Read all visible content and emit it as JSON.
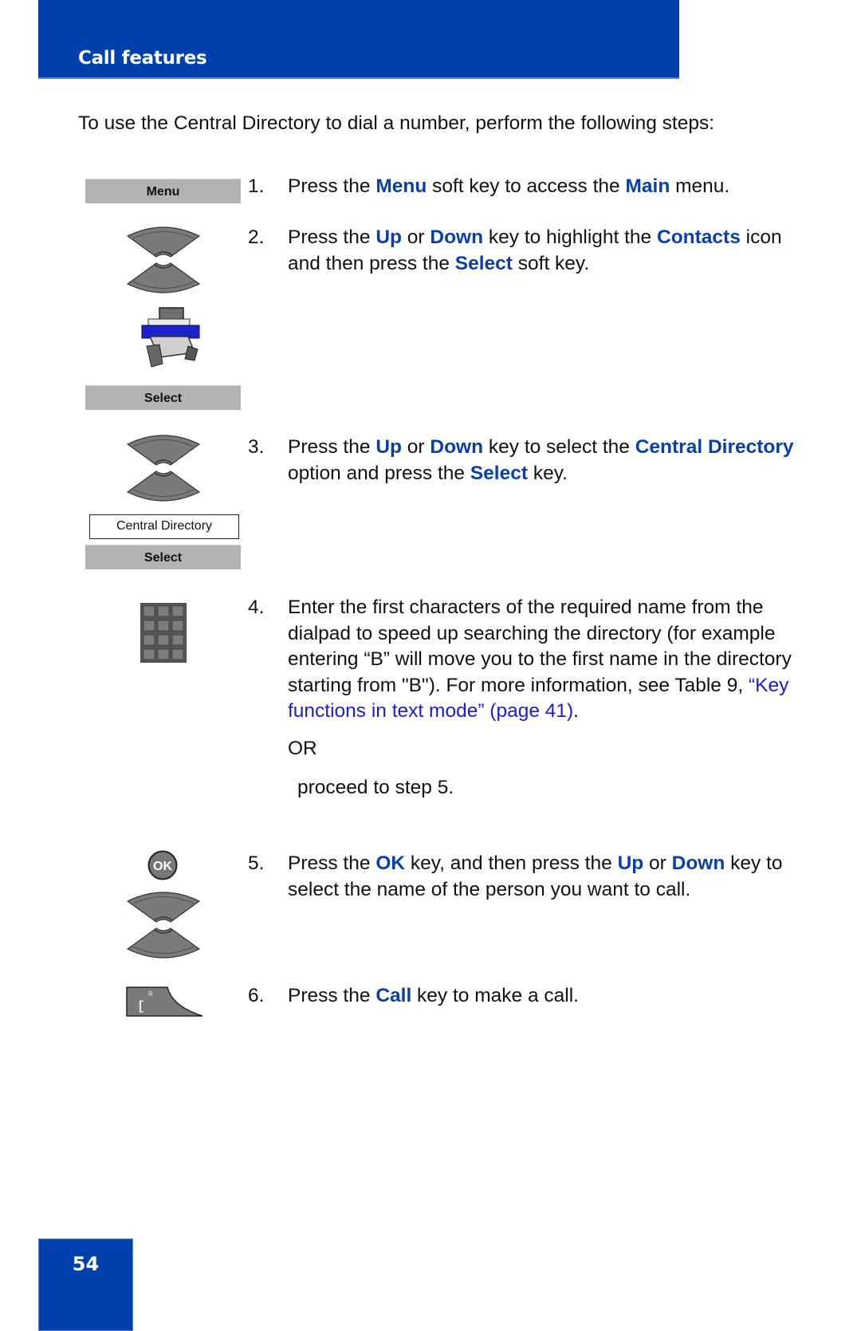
{
  "header": {
    "title": "Call features"
  },
  "intro": "To use the Central Directory to dial a number, perform the following steps:",
  "softkeys": {
    "menu": "Menu",
    "select_1": "Select",
    "select_2": "Select"
  },
  "screen_item": "Central Directory",
  "icons": {
    "nav_1": "up-down-navigation-keys-icon",
    "contacts": "contacts-rolodex-icon",
    "nav_2": "up-down-navigation-keys-icon",
    "dialpad": "dialpad-icon",
    "ok": "ok-key-icon",
    "nav_3": "up-down-navigation-keys-icon",
    "call": "call-key-icon"
  },
  "ok_key_label": "OK",
  "call_key_labels": {
    "main": "[",
    "sup": "R"
  },
  "steps": [
    {
      "num": "1.",
      "parts": [
        {
          "t": "Press the ",
          "s": "plain"
        },
        {
          "t": "Menu",
          "s": "kw"
        },
        {
          "t": " soft key to access the ",
          "s": "plain"
        },
        {
          "t": "Main",
          "s": "kw"
        },
        {
          "t": " menu.",
          "s": "plain"
        }
      ]
    },
    {
      "num": "2.",
      "parts": [
        {
          "t": "Press the ",
          "s": "plain"
        },
        {
          "t": "Up",
          "s": "kw"
        },
        {
          "t": " or ",
          "s": "plain"
        },
        {
          "t": "Down",
          "s": "kw"
        },
        {
          "t": " key to highlight the ",
          "s": "plain"
        },
        {
          "t": "Contacts",
          "s": "kw"
        },
        {
          "t": " icon and then press the ",
          "s": "plain"
        },
        {
          "t": "Select",
          "s": "kw"
        },
        {
          "t": " soft key.",
          "s": "plain"
        }
      ]
    },
    {
      "num": "3.",
      "parts": [
        {
          "t": "Press the ",
          "s": "plain"
        },
        {
          "t": "Up",
          "s": "kw"
        },
        {
          "t": " or ",
          "s": "plain"
        },
        {
          "t": "Down",
          "s": "kw"
        },
        {
          "t": " key to select the ",
          "s": "plain"
        },
        {
          "t": "Central Directory",
          "s": "kw"
        },
        {
          "t": " option and press the ",
          "s": "plain"
        },
        {
          "t": "Select",
          "s": "kw"
        },
        {
          "t": " key.",
          "s": "plain"
        }
      ]
    },
    {
      "num": "4.",
      "parts": [
        {
          "t": "Enter the first characters of the required name from the dialpad to speed up searching the directory (for example entering “B” will move you to the first name in the directory starting from \"B\"). For more information, see Table 9, ",
          "s": "plain"
        },
        {
          "t": "“Key functions in text mode” (page 41)",
          "s": "lnk"
        },
        {
          "t": ".",
          "s": "plain"
        }
      ]
    },
    {
      "num": "5.",
      "parts": [
        {
          "t": "Press the ",
          "s": "plain"
        },
        {
          "t": "OK",
          "s": "kw"
        },
        {
          "t": " key, and then press the ",
          "s": "plain"
        },
        {
          "t": "Up",
          "s": "kw"
        },
        {
          "t": " or ",
          "s": "plain"
        },
        {
          "t": "Down",
          "s": "kw"
        },
        {
          "t": " key to select the name of the person you want to call.",
          "s": "plain"
        }
      ]
    },
    {
      "num": "6.",
      "parts": [
        {
          "t": "Press the ",
          "s": "plain"
        },
        {
          "t": "Call",
          "s": "kw"
        },
        {
          "t": " key to make a call.",
          "s": "plain"
        }
      ]
    }
  ],
  "or_text": "OR",
  "proceed_text": "proceed to step 5.",
  "page_number": "54"
}
